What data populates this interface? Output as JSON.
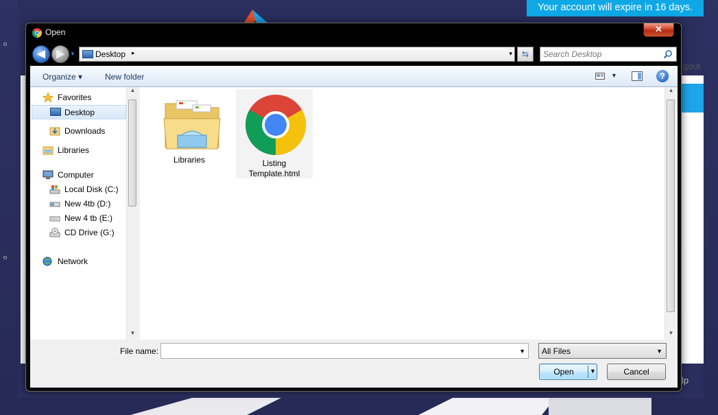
{
  "background": {
    "banner_text": "Your account will expire in 16 days.",
    "logout_text": "gout",
    "help_text": "lp",
    "accent": "#0fa8e6"
  },
  "dialog": {
    "title": "Open",
    "title_icon": "chrome-icon",
    "close_glyph": "✕",
    "address": {
      "location": "Desktop",
      "chevron": "▸",
      "drop": "▾"
    },
    "search": {
      "placeholder": "Search Desktop"
    },
    "toolbar": {
      "organize": "Organize ▾",
      "new_folder": "New folder",
      "help_glyph": "?"
    },
    "nav": {
      "favorites": "Favorites",
      "desktop": "Desktop",
      "downloads": "Downloads",
      "libraries": "Libraries",
      "computer": "Computer",
      "local_disk": "Local Disk (C:)",
      "new_4tb_d": "New 4tb (D:)",
      "new_4tb_e": "New 4 tb (E:)",
      "cd_drive": "CD Drive (G:)",
      "network": "Network"
    },
    "files": [
      {
        "name": "Libraries",
        "icon": "libraries-folder-icon"
      },
      {
        "name_line1": "Listing",
        "name_line2": "Template.html",
        "icon": "chrome-icon"
      }
    ],
    "bottom": {
      "filename_label": "File name:",
      "filename_value": "",
      "filetype": "All Files",
      "open_label": "Open",
      "cancel_label": "Cancel"
    }
  }
}
